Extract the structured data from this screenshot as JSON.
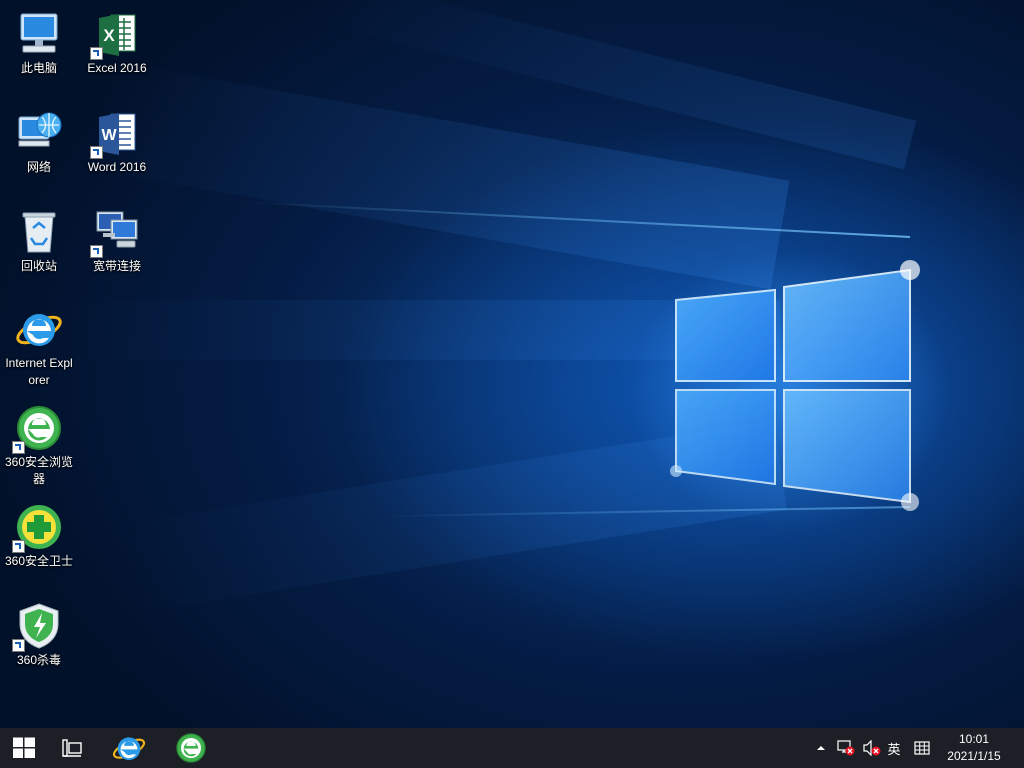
{
  "desktop": {
    "icons": [
      {
        "id": "this-pc",
        "label": "此电脑"
      },
      {
        "id": "network",
        "label": "网络"
      },
      {
        "id": "recycle-bin",
        "label": "回收站"
      },
      {
        "id": "internet-explorer",
        "label": "Internet Explorer"
      },
      {
        "id": "360-browser",
        "label": "360安全浏览器"
      },
      {
        "id": "360-safeguard",
        "label": "360安全卫士"
      },
      {
        "id": "360-antivirus",
        "label": "360杀毒"
      },
      {
        "id": "excel-2016",
        "label": "Excel 2016"
      },
      {
        "id": "word-2016",
        "label": "Word 2016"
      },
      {
        "id": "broadband-connection",
        "label": "宽带连接"
      }
    ]
  },
  "taskbar": {
    "start_icon": "windows-logo-icon",
    "task_view_icon": "task-view-icon",
    "pinned": [
      {
        "id": "internet-explorer",
        "icon": "ie-icon"
      },
      {
        "id": "360-browser",
        "icon": "360-browser-icon"
      }
    ],
    "tray": {
      "show_hidden_icon": "chevron-up-icon",
      "network_icon": "network-disconnected-icon",
      "volume_icon": "volume-muted-icon",
      "ime_label": "英",
      "ime_mode_icon": "ime-grid-icon"
    },
    "clock": {
      "time": "10:01",
      "date": "2021/1/15"
    }
  },
  "colors": {
    "taskbar_bg": "#1c2026",
    "wallpaper_dark": "#031a3c",
    "wallpaper_glow": "#1e7bff"
  }
}
